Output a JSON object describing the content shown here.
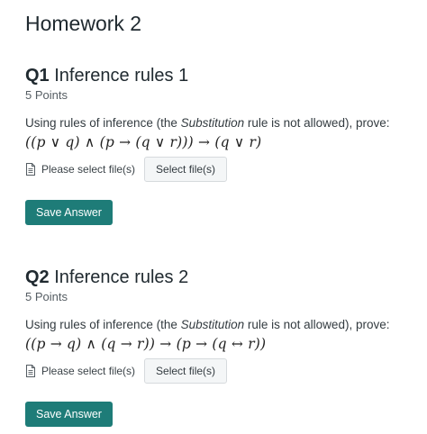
{
  "page": {
    "title": "Homework 2"
  },
  "questions": [
    {
      "number": "Q1",
      "title": "Inference rules 1",
      "points": "5 Points",
      "prompt_before": "Using rules of inference (the ",
      "prompt_emphasis": "Substitution",
      "prompt_after": " rule is not allowed), prove:",
      "formula": "((p ∨ q) ∧ (p → (q ∨ r))) → (q ∨ r)",
      "file_label": "Please select file(s)",
      "select_button": "Select file(s)",
      "save_button": "Save Answer"
    },
    {
      "number": "Q2",
      "title": "Inference rules 2",
      "points": "5 Points",
      "prompt_before": "Using rules of inference (the ",
      "prompt_emphasis": "Substitution",
      "prompt_after": " rule is not allowed), prove:",
      "formula": "((p → q) ∧ (q → r)) → (p → (q ↔ r))",
      "file_label": "Please select file(s)",
      "select_button": "Select file(s)",
      "save_button": "Save Answer"
    }
  ],
  "colors": {
    "save_button_bg": "#1e7c78",
    "select_button_bg": "#f4f6f7"
  },
  "icons": {
    "file": "file-icon"
  }
}
